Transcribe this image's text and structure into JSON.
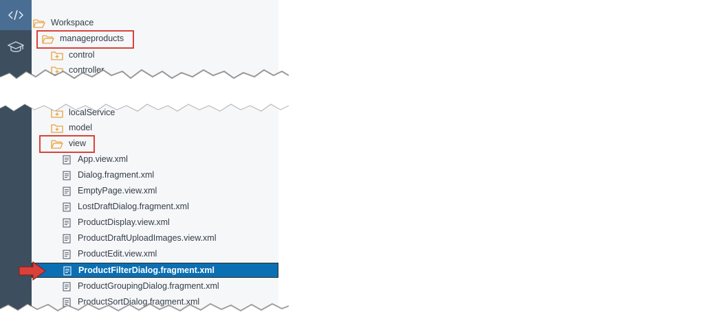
{
  "sidebar": {
    "items": [
      {
        "icon": "code-icon",
        "active": true
      },
      {
        "icon": "graduation-cap-icon",
        "active": false
      }
    ]
  },
  "tree": {
    "rows": [
      {
        "type": "folder-open",
        "label": "Workspace"
      },
      {
        "type": "folder-open",
        "label": "manageproducts"
      },
      {
        "type": "folder-closed",
        "label": "control"
      },
      {
        "type": "folder-closed",
        "label": "controller"
      },
      {
        "type": "folder-closed",
        "label": "localService"
      },
      {
        "type": "folder-closed",
        "label": "model"
      },
      {
        "type": "folder-open",
        "label": "view"
      },
      {
        "type": "file",
        "label": "App.view.xml"
      },
      {
        "type": "file",
        "label": "Dialog.fragment.xml"
      },
      {
        "type": "file",
        "label": "EmptyPage.view.xml"
      },
      {
        "type": "file",
        "label": "LostDraftDialog.fragment.xml"
      },
      {
        "type": "file",
        "label": "ProductDisplay.view.xml"
      },
      {
        "type": "file",
        "label": "ProductDraftUploadImages.view.xml"
      },
      {
        "type": "file",
        "label": "ProductEdit.view.xml"
      },
      {
        "type": "file",
        "label": "ProductFilterDialog.fragment.xml",
        "selected": true
      },
      {
        "type": "file",
        "label": "ProductGroupingDialog.fragment.xml"
      },
      {
        "type": "file",
        "label": "ProductSortDialog.fragment.xml"
      }
    ]
  },
  "colors": {
    "sidebar_bg": "#3d4e5e",
    "sidebar_active": "#4a6e93",
    "tree_bg": "#f6f7f9",
    "selected_bg": "#0a6fb3",
    "folder": "#e8a33d",
    "highlight": "#d9413a"
  }
}
